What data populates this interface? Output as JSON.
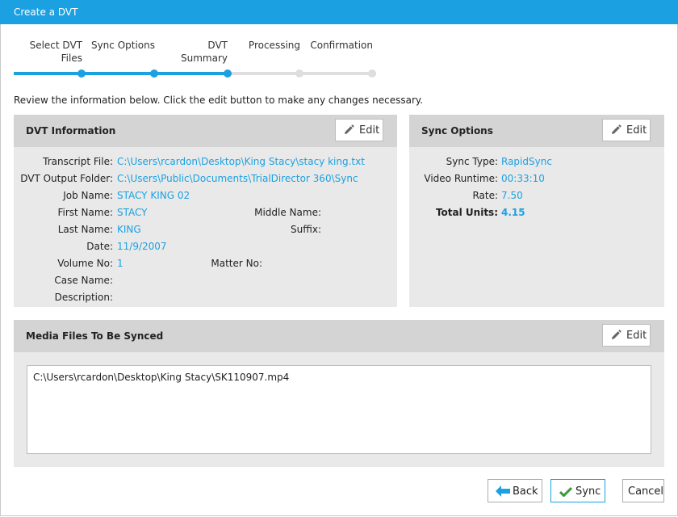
{
  "window": {
    "title": "Create a DVT"
  },
  "wizard": {
    "steps": [
      {
        "label_line1": "Select DVT",
        "label_line2": "Files"
      },
      {
        "label_line1": "Sync Options",
        "label_line2": ""
      },
      {
        "label_line1": "DVT",
        "label_line2": "Summary"
      },
      {
        "label_line1": "Processing",
        "label_line2": ""
      },
      {
        "label_line1": "Confirmation",
        "label_line2": ""
      }
    ],
    "current_step": 3,
    "total_steps": 5
  },
  "instructions": "Review the information below. Click the edit button to make any changes necessary.",
  "dvt_info": {
    "title": "DVT Information",
    "edit_label": "Edit",
    "transcript_file_label": "Transcript File:",
    "transcript_file": "C:\\Users\\rcardon\\Desktop\\King Stacy\\stacy king.txt",
    "output_folder_label": "DVT Output Folder:",
    "output_folder": "C:\\Users\\Public\\Documents\\TrialDirector 360\\Sync",
    "job_name_label": "Job Name:",
    "job_name": "STACY KING 02",
    "first_name_label": "First Name:",
    "first_name": "STACY",
    "middle_name_label": "Middle Name:",
    "middle_name": "",
    "last_name_label": "Last Name:",
    "last_name": "KING",
    "suffix_label": "Suffix:",
    "suffix": "",
    "date_label": "Date:",
    "date": "11/9/2007",
    "volume_no_label": "Volume No:",
    "volume_no": "1",
    "matter_no_label": "Matter No:",
    "matter_no": "",
    "case_name_label": "Case Name:",
    "case_name": "",
    "description_label": "Description:",
    "description": ""
  },
  "sync_options": {
    "title": "Sync Options",
    "edit_label": "Edit",
    "sync_type_label": "Sync Type:",
    "sync_type": "RapidSync",
    "video_runtime_label": "Video Runtime:",
    "video_runtime": "00:33:10",
    "rate_label": "Rate:",
    "rate": "7.50",
    "total_units_label": "Total Units:",
    "total_units": "4.15"
  },
  "media_files": {
    "title": "Media Files To Be Synced",
    "edit_label": "Edit",
    "files": [
      "C:\\Users\\rcardon\\Desktop\\King Stacy\\SK110907.mp4"
    ]
  },
  "footer": {
    "back_label": "Back",
    "sync_label": "Sync",
    "cancel_label": "Cancel"
  },
  "colors": {
    "accent": "#1ba1e2",
    "check_green": "#3a9a3a",
    "panel_bg": "#e9e9e9",
    "panel_header": "#d4d4d4",
    "step_inactive": "#dedede"
  },
  "icons": {
    "edit": "pencil-icon",
    "back": "arrow-left-icon",
    "sync": "checkmark-icon"
  }
}
